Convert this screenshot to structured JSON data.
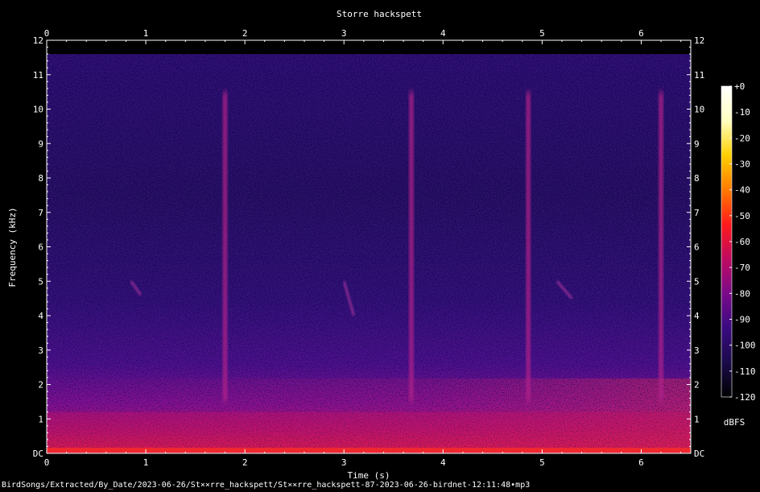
{
  "chart_data": {
    "type": "heatmap",
    "title": "Storre hackspett",
    "xlabel": "Time (s)",
    "ylabel": "Frequency (kHz)",
    "xlim": [
      0,
      6.5
    ],
    "ylim": [
      0,
      12
    ],
    "x_ticks": [
      "0",
      "1",
      "2",
      "3",
      "4",
      "5",
      "6"
    ],
    "y_ticks": [
      "DC",
      "1",
      "2",
      "3",
      "4",
      "5",
      "6",
      "7",
      "8",
      "9",
      "10",
      "11",
      "12"
    ],
    "colorbar": {
      "label": "dBFS",
      "range": [
        -120,
        0
      ],
      "ticks": [
        "+0",
        "-10",
        "-20",
        "-30",
        "-40",
        "-50",
        "-60",
        "-70",
        "-80",
        "-90",
        "-100",
        "-110",
        "-120"
      ],
      "colors": [
        "#000000",
        "#1a0a4a",
        "#3a0a80",
        "#7a0a8a",
        "#c00a60",
        "#ff1a1a",
        "#ff7a00",
        "#ffd000",
        "#ffffc0",
        "#ffffff"
      ]
    },
    "signal_content_max_khz": 11.6,
    "drum_events": [
      {
        "time_s": 1.8,
        "freq_range_khz": [
          1.5,
          10.5
        ]
      },
      {
        "time_s": 3.68,
        "freq_range_khz": [
          1.5,
          10.5
        ]
      },
      {
        "time_s": 4.86,
        "freq_range_khz": [
          1.5,
          10.5
        ]
      },
      {
        "time_s": 6.2,
        "freq_range_khz": [
          1.5,
          10.5
        ]
      }
    ],
    "call_traces": [
      {
        "time_s": [
          3.0,
          3.1
        ],
        "freq_khz": [
          5.0,
          4.0
        ]
      },
      {
        "time_s": [
          5.15,
          5.3
        ],
        "freq_khz": [
          5.0,
          4.5
        ]
      },
      {
        "time_s": [
          0.85,
          0.95
        ],
        "freq_khz": [
          5.0,
          4.6
        ]
      }
    ],
    "low_frequency_band_khz": [
      0,
      1.2
    ]
  },
  "footer": {
    "file_path": "BirdSongs/Extracted/By_Date/2023-06-26/St××rre_hackspett/St××rre_hackspett-87-2023-06-26-birdnet-12:11:48•mp3"
  }
}
